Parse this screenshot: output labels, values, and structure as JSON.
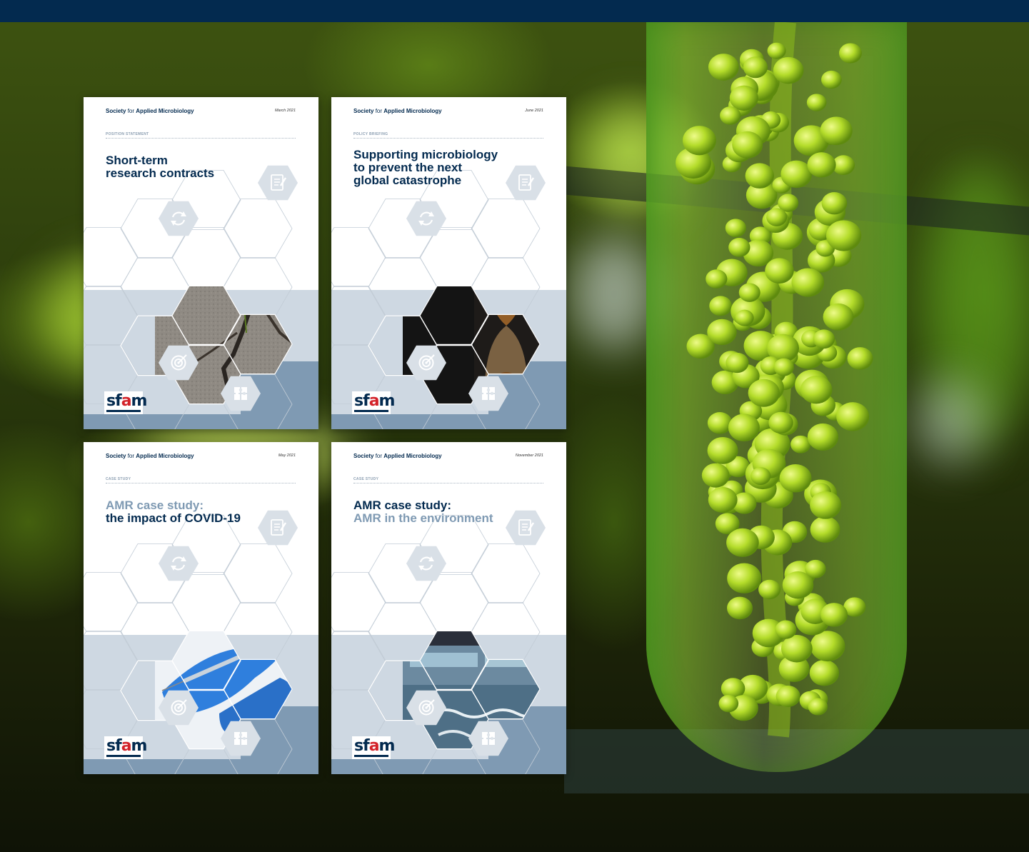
{
  "covers": [
    {
      "society_prefix": "Society",
      "society_for": "for",
      "society_name": "Applied Microbiology",
      "date": "March 2021",
      "label": "POSITION STATEMENT",
      "title_lines": [
        "Short-term",
        "research contracts"
      ],
      "image": "cracked-ground-daisy",
      "logo": "sfam"
    },
    {
      "society_prefix": "Society",
      "society_for": "for",
      "society_name": "Applied Microbiology",
      "date": "June 2021",
      "label": "POLICY BRIEFING",
      "title_lines": [
        "Supporting microbiology",
        "to prevent the next",
        "global catastrophe"
      ],
      "image": "hourglass-earth",
      "logo": "sfam"
    },
    {
      "society_prefix": "Society",
      "society_for": "for",
      "society_name": "Applied Microbiology",
      "date": "May 2021",
      "label": "CASE STUDY",
      "title_lines": [
        "AMR case study:",
        "the impact of COVID-19"
      ],
      "title_highlight_line": 0,
      "image": "covid-vaccine-syringe",
      "logo": "sfam"
    },
    {
      "society_prefix": "Society",
      "society_for": "for",
      "society_name": "Applied Microbiology",
      "date": "November 2021",
      "label": "CASE STUDY",
      "title_lines": [
        "AMR case study:",
        "AMR in the environment"
      ],
      "title_highlight_line": 1,
      "image": "water-treatment-plant",
      "logo": "sfam"
    }
  ],
  "colors": {
    "navy": "#032a4f",
    "slate": "#7f9ab3",
    "pale": "#ced8e2",
    "logo_red": "#d3232a"
  },
  "icons": [
    "document-icon",
    "refresh-icon",
    "target-icon",
    "puzzle-icon"
  ],
  "logo_text": {
    "s": "s",
    "f": "f",
    "a": "a",
    "m": "m"
  }
}
